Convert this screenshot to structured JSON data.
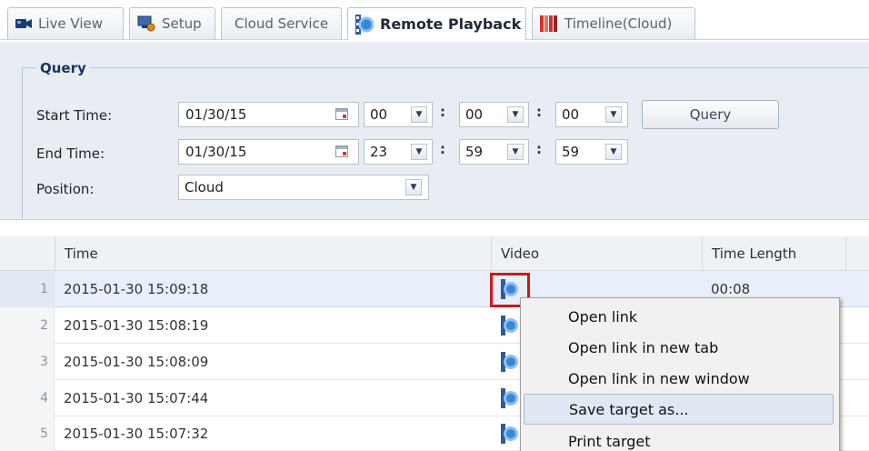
{
  "tabs": [
    {
      "label": "Live View",
      "icon": "camera-icon",
      "active": false
    },
    {
      "label": "Setup",
      "icon": "setup-icon",
      "active": false
    },
    {
      "label": "Cloud Service",
      "icon": "",
      "active": false
    },
    {
      "label": "Remote Playback",
      "icon": "film-icon",
      "active": true
    },
    {
      "label": "Timeline(Cloud)",
      "icon": "timeline-icon",
      "active": false
    }
  ],
  "query": {
    "legend": "Query",
    "start_label": "Start Time:",
    "end_label": "End Time:",
    "position_label": "Position:",
    "start_date": "01/30/15",
    "start_h": "00",
    "start_m": "00",
    "start_s": "00",
    "end_date": "01/30/15",
    "end_h": "23",
    "end_m": "59",
    "end_s": "59",
    "position_value": "Cloud",
    "colon": ":",
    "button": "Query"
  },
  "table": {
    "headers": [
      "Time",
      "Video",
      "Time Length"
    ],
    "rows": [
      {
        "num": "1",
        "time": "2015-01-30 15:09:18",
        "length": "00:08"
      },
      {
        "num": "2",
        "time": "2015-01-30 15:08:19",
        "length": ""
      },
      {
        "num": "3",
        "time": "2015-01-30 15:08:09",
        "length": ""
      },
      {
        "num": "4",
        "time": "2015-01-30 15:07:44",
        "length": ""
      },
      {
        "num": "5",
        "time": "2015-01-30 15:07:32",
        "length": ""
      }
    ]
  },
  "context_menu": {
    "items": [
      "Open link",
      "Open link in new tab",
      "Open link in new window",
      "Save target as...",
      "Print target"
    ],
    "hovered": "Save target as..."
  },
  "colors": {
    "highlight": "#d0161a",
    "legend": "#17355f",
    "panel_bg": "#e8edf3"
  }
}
